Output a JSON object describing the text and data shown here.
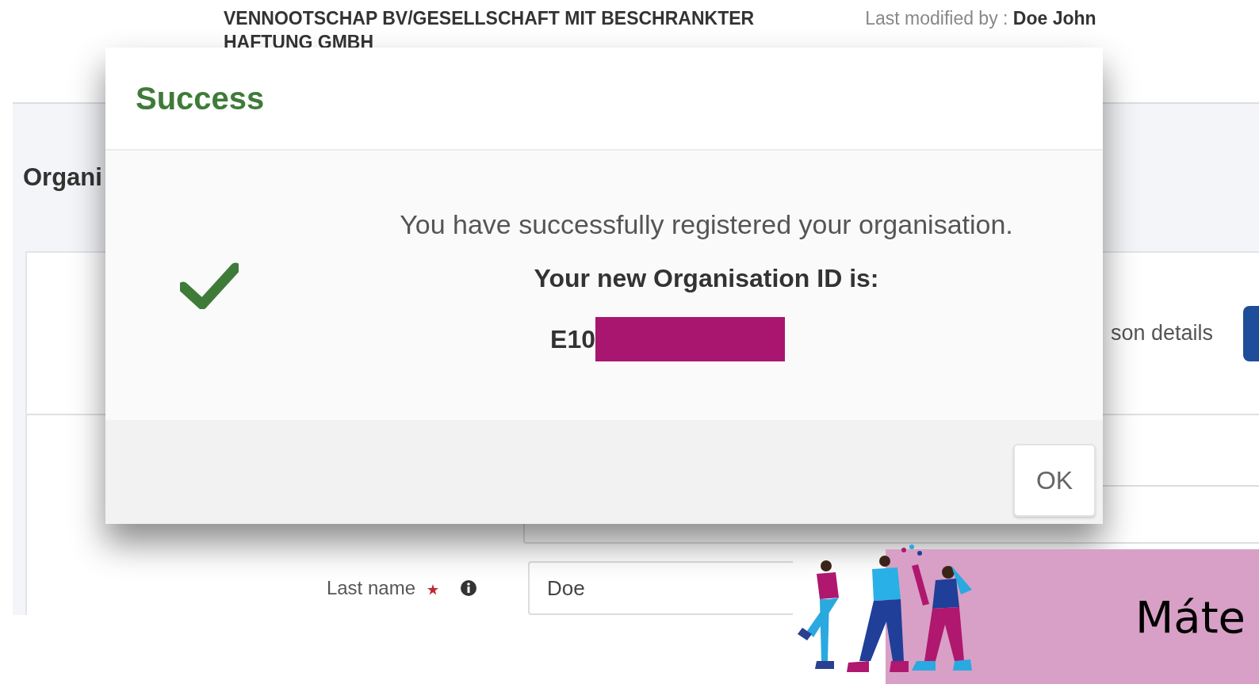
{
  "background_page": {
    "org_name_lines": [
      "VENNOOTSCHAP BV/GESELLSCHAFT MIT BESCHRANKTER",
      "HAFTUNG GMBH"
    ],
    "last_modified_label": "Last modified by : ",
    "last_modified_value": "Doe John",
    "section_title": "Organi",
    "step_label": "son details",
    "fields": [
      {
        "label": "Last name",
        "required": true,
        "value": "Doe"
      }
    ]
  },
  "dialog": {
    "title": "Success",
    "message": "You have successfully registered your organisation.",
    "id_label": "Your new Organisation ID is:",
    "id_value": "E10",
    "id_redacted": true,
    "buttons": [
      "OK"
    ]
  },
  "banner": {
    "text": "Máte"
  }
}
